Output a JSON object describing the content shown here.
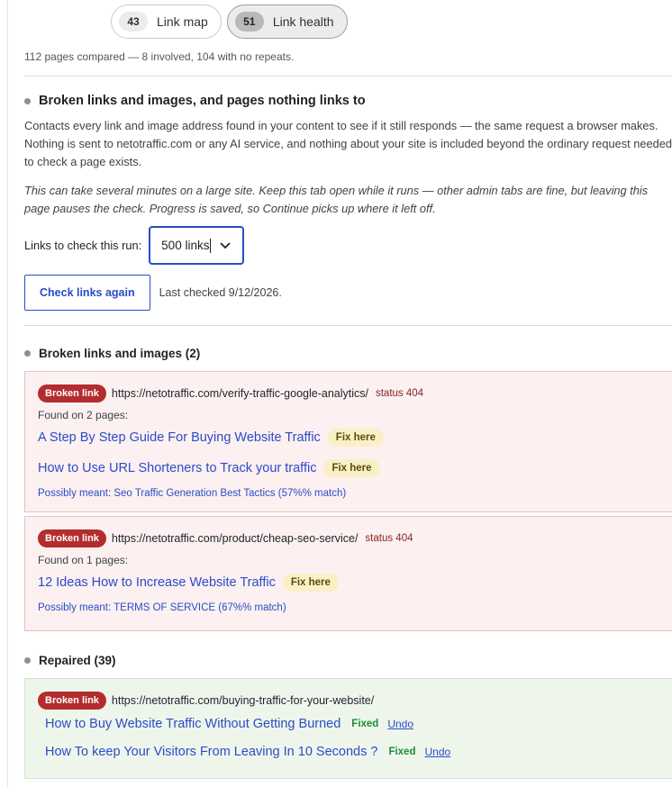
{
  "tabs": [
    {
      "count": "43",
      "label": "Link map"
    },
    {
      "count": "51",
      "label": "Link health"
    }
  ],
  "summary": "112 pages compared — 8 involved, 104 with no repeats.",
  "check_section": {
    "title": "Broken links and images, and pages nothing links to",
    "description": "Contacts every link and image address found in your content to see if it still responds — the same request a browser makes. Nothing is sent to netotraffic.com or any AI service, and nothing about your site is included beyond the ordinary request needed to check a page exists.",
    "note": "This can take several minutes on a large site. Keep this tab open while it runs — other admin tabs are fine, but leaving this page pauses the check. Progress is saved, so Continue picks up where it left off.",
    "run_label": "Links to check this run:",
    "run_value": "500 links",
    "check_button": "Check links again",
    "last_checked": "Last checked 9/12/2026."
  },
  "broken_section": {
    "title": "Broken links and images (2)",
    "items": [
      {
        "badge": "Broken link",
        "url": "https://netotraffic.com/verify-traffic-google-analytics/",
        "status": "status 404",
        "found": "Found on 2 pages:",
        "pages": [
          {
            "title": "A Step By Step Guide For Buying Website Traffic",
            "action": "Fix here"
          },
          {
            "title": "How to Use URL Shorteners to Track your traffic",
            "action": "Fix here"
          }
        ],
        "meant": "Possibly meant: Seo Traffic Generation Best Tactics (57%% match)"
      },
      {
        "badge": "Broken link",
        "url": "https://netotraffic.com/product/cheap-seo-service/",
        "status": "status 404",
        "found": "Found on 1 pages:",
        "pages": [
          {
            "title": "12 Ideas How to Increase Website Traffic",
            "action": "Fix here"
          }
        ],
        "meant": "Possibly meant: TERMS OF SERVICE (67%% match)"
      }
    ]
  },
  "repaired_section": {
    "title": "Repaired (39)",
    "item": {
      "badge": "Broken link",
      "url": "https://netotraffic.com/buying-traffic-for-your-website/",
      "pages": [
        {
          "title": "How to Buy Website Traffic Without Getting Burned",
          "status": "Fixed",
          "undo": "Undo"
        },
        {
          "title": "How To keep Your Visitors From Leaving In 10 Seconds ?",
          "status": "Fixed",
          "undo": "Undo"
        }
      ]
    }
  },
  "colors": {
    "accent": "#2a4cc7",
    "broken_badge": "#b32d2e",
    "fixed": "#1e8c35",
    "broken_card_bg": "#fcf0f1",
    "repaired_card_bg": "#eef6ec"
  }
}
